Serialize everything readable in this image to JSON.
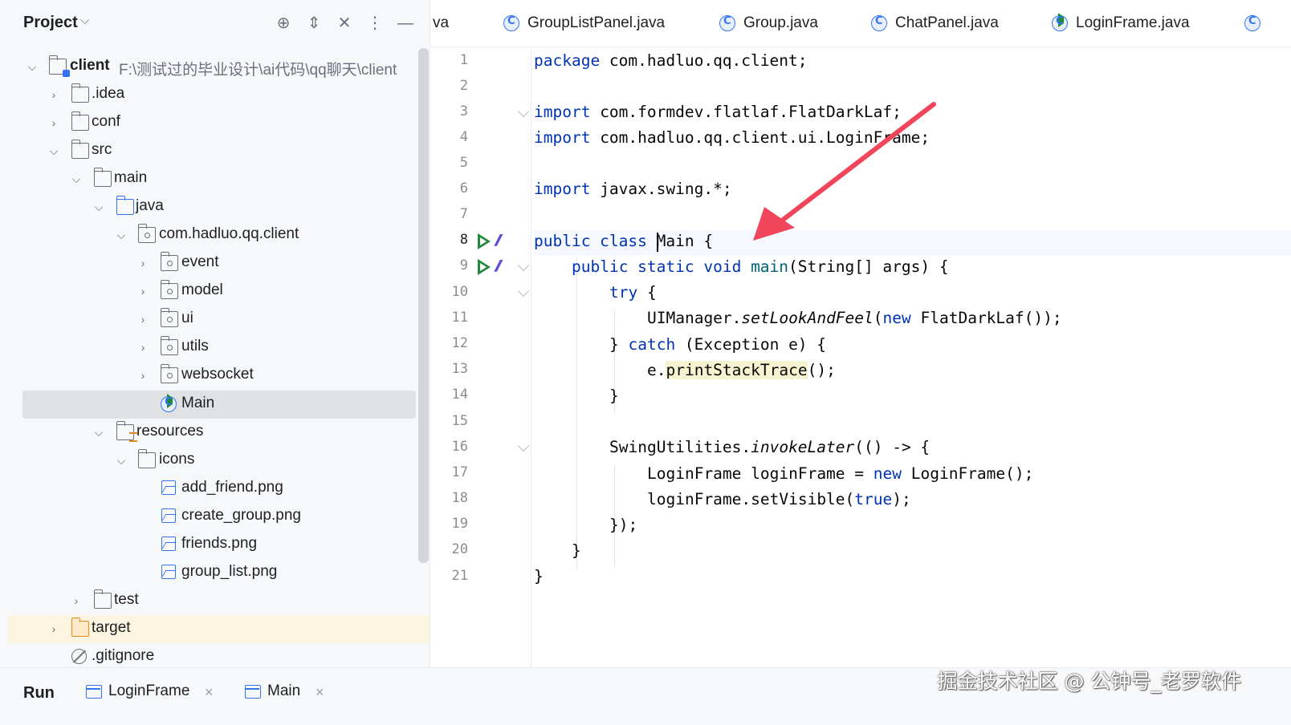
{
  "project_panel": {
    "title": "Project",
    "tree": [
      {
        "label": "client",
        "path": "F:\\测试过的毕业设计\\ai代码\\qq聊天\\client",
        "icon": "module-folder-icon",
        "expanded": true
      },
      {
        "label": ".idea",
        "icon": "folder-icon",
        "expanded": false
      },
      {
        "label": "conf",
        "icon": "folder-icon",
        "expanded": false
      },
      {
        "label": "src",
        "icon": "folder-icon",
        "expanded": true
      },
      {
        "label": "main",
        "icon": "folder-icon",
        "expanded": true
      },
      {
        "label": "java",
        "icon": "source-folder-icon",
        "expanded": true
      },
      {
        "label": "com.hadluo.qq.client",
        "icon": "package-icon",
        "expanded": true
      },
      {
        "label": "event",
        "icon": "package-icon",
        "expanded": false
      },
      {
        "label": "model",
        "icon": "package-icon",
        "expanded": false
      },
      {
        "label": "ui",
        "icon": "package-icon",
        "expanded": false
      },
      {
        "label": "utils",
        "icon": "package-icon",
        "expanded": false
      },
      {
        "label": "websocket",
        "icon": "package-icon",
        "expanded": false
      },
      {
        "label": "Main",
        "icon": "main-class-icon",
        "selected": true
      },
      {
        "label": "resources",
        "icon": "resources-folder-icon",
        "expanded": true
      },
      {
        "label": "icons",
        "icon": "folder-icon",
        "expanded": true
      },
      {
        "label": "add_friend.png",
        "icon": "image-file-icon"
      },
      {
        "label": "create_group.png",
        "icon": "image-file-icon"
      },
      {
        "label": "friends.png",
        "icon": "image-file-icon"
      },
      {
        "label": "group_list.png",
        "icon": "image-file-icon"
      },
      {
        "label": "test",
        "icon": "folder-icon",
        "expanded": false
      },
      {
        "label": "target",
        "icon": "excluded-folder-icon",
        "expanded": false
      },
      {
        "label": ".gitignore",
        "icon": "ignore-file-icon"
      }
    ]
  },
  "tabs": [
    {
      "label": "va"
    },
    {
      "label": "GroupListPanel.java",
      "icon": "class-icon"
    },
    {
      "label": "Group.java",
      "icon": "class-icon"
    },
    {
      "label": "ChatPanel.java",
      "icon": "class-icon"
    },
    {
      "label": "LoginFrame.java",
      "icon": "class-icon"
    }
  ],
  "editor": {
    "current_line": 8,
    "line_numbers": [
      "1",
      "2",
      "3",
      "4",
      "5",
      "6",
      "7",
      "8",
      "9",
      "10",
      "11",
      "12",
      "13",
      "14",
      "15",
      "16",
      "17",
      "18",
      "19",
      "20",
      "21"
    ],
    "code": {
      "l1_kw": "package",
      "l1_rest": " com.hadluo.qq.client;",
      "l3_kw": "import",
      "l3_rest": " com.formdev.flatlaf.FlatDarkLaf;",
      "l4_kw": "import",
      "l4_rest": " com.hadluo.qq.client.ui.LoginFrame;",
      "l6_kw": "import",
      "l6_rest": " javax.swing.*;",
      "l8_kw": "public class ",
      "l8_name": "Main",
      "l8_rest": " {",
      "l9_kw": "public static void ",
      "l9_name": "main",
      "l9_rest": "(String[] args) {",
      "l10_kw": "try",
      "l10_rest": " {",
      "l11_a": "UIManager.",
      "l11_method": "setLookAndFeel",
      "l11_b": "(",
      "l11_kw": "new",
      "l11_c": " FlatDarkLaf());",
      "l12_a": "} ",
      "l12_kw": "catch",
      "l12_b": " (Exception e) {",
      "l13_a": "e.",
      "l13_method": "printStackTrace",
      "l13_b": "();",
      "l14": "}",
      "l16_a": "SwingUtilities.",
      "l16_method": "invokeLater",
      "l16_b": "(() -> {",
      "l17_a": "LoginFrame loginFrame = ",
      "l17_kw": "new",
      "l17_b": " LoginFrame();",
      "l18_a": "loginFrame.setVisible(",
      "l18_kw": "true",
      "l18_b": ");",
      "l19": "});",
      "l20": "}",
      "l21": "}"
    }
  },
  "run_bar": {
    "title": "Run",
    "tabs": [
      {
        "label": "LoginFrame",
        "close": "×"
      },
      {
        "label": "Main",
        "close": "×"
      }
    ]
  },
  "watermark": "掘金技术社区 @ 公钟号_老罗软件",
  "colors": {
    "keyword": "#0033b3",
    "accent": "#3574f0",
    "run_green": "#208a3c",
    "annotation_arrow": "#f0455a"
  }
}
